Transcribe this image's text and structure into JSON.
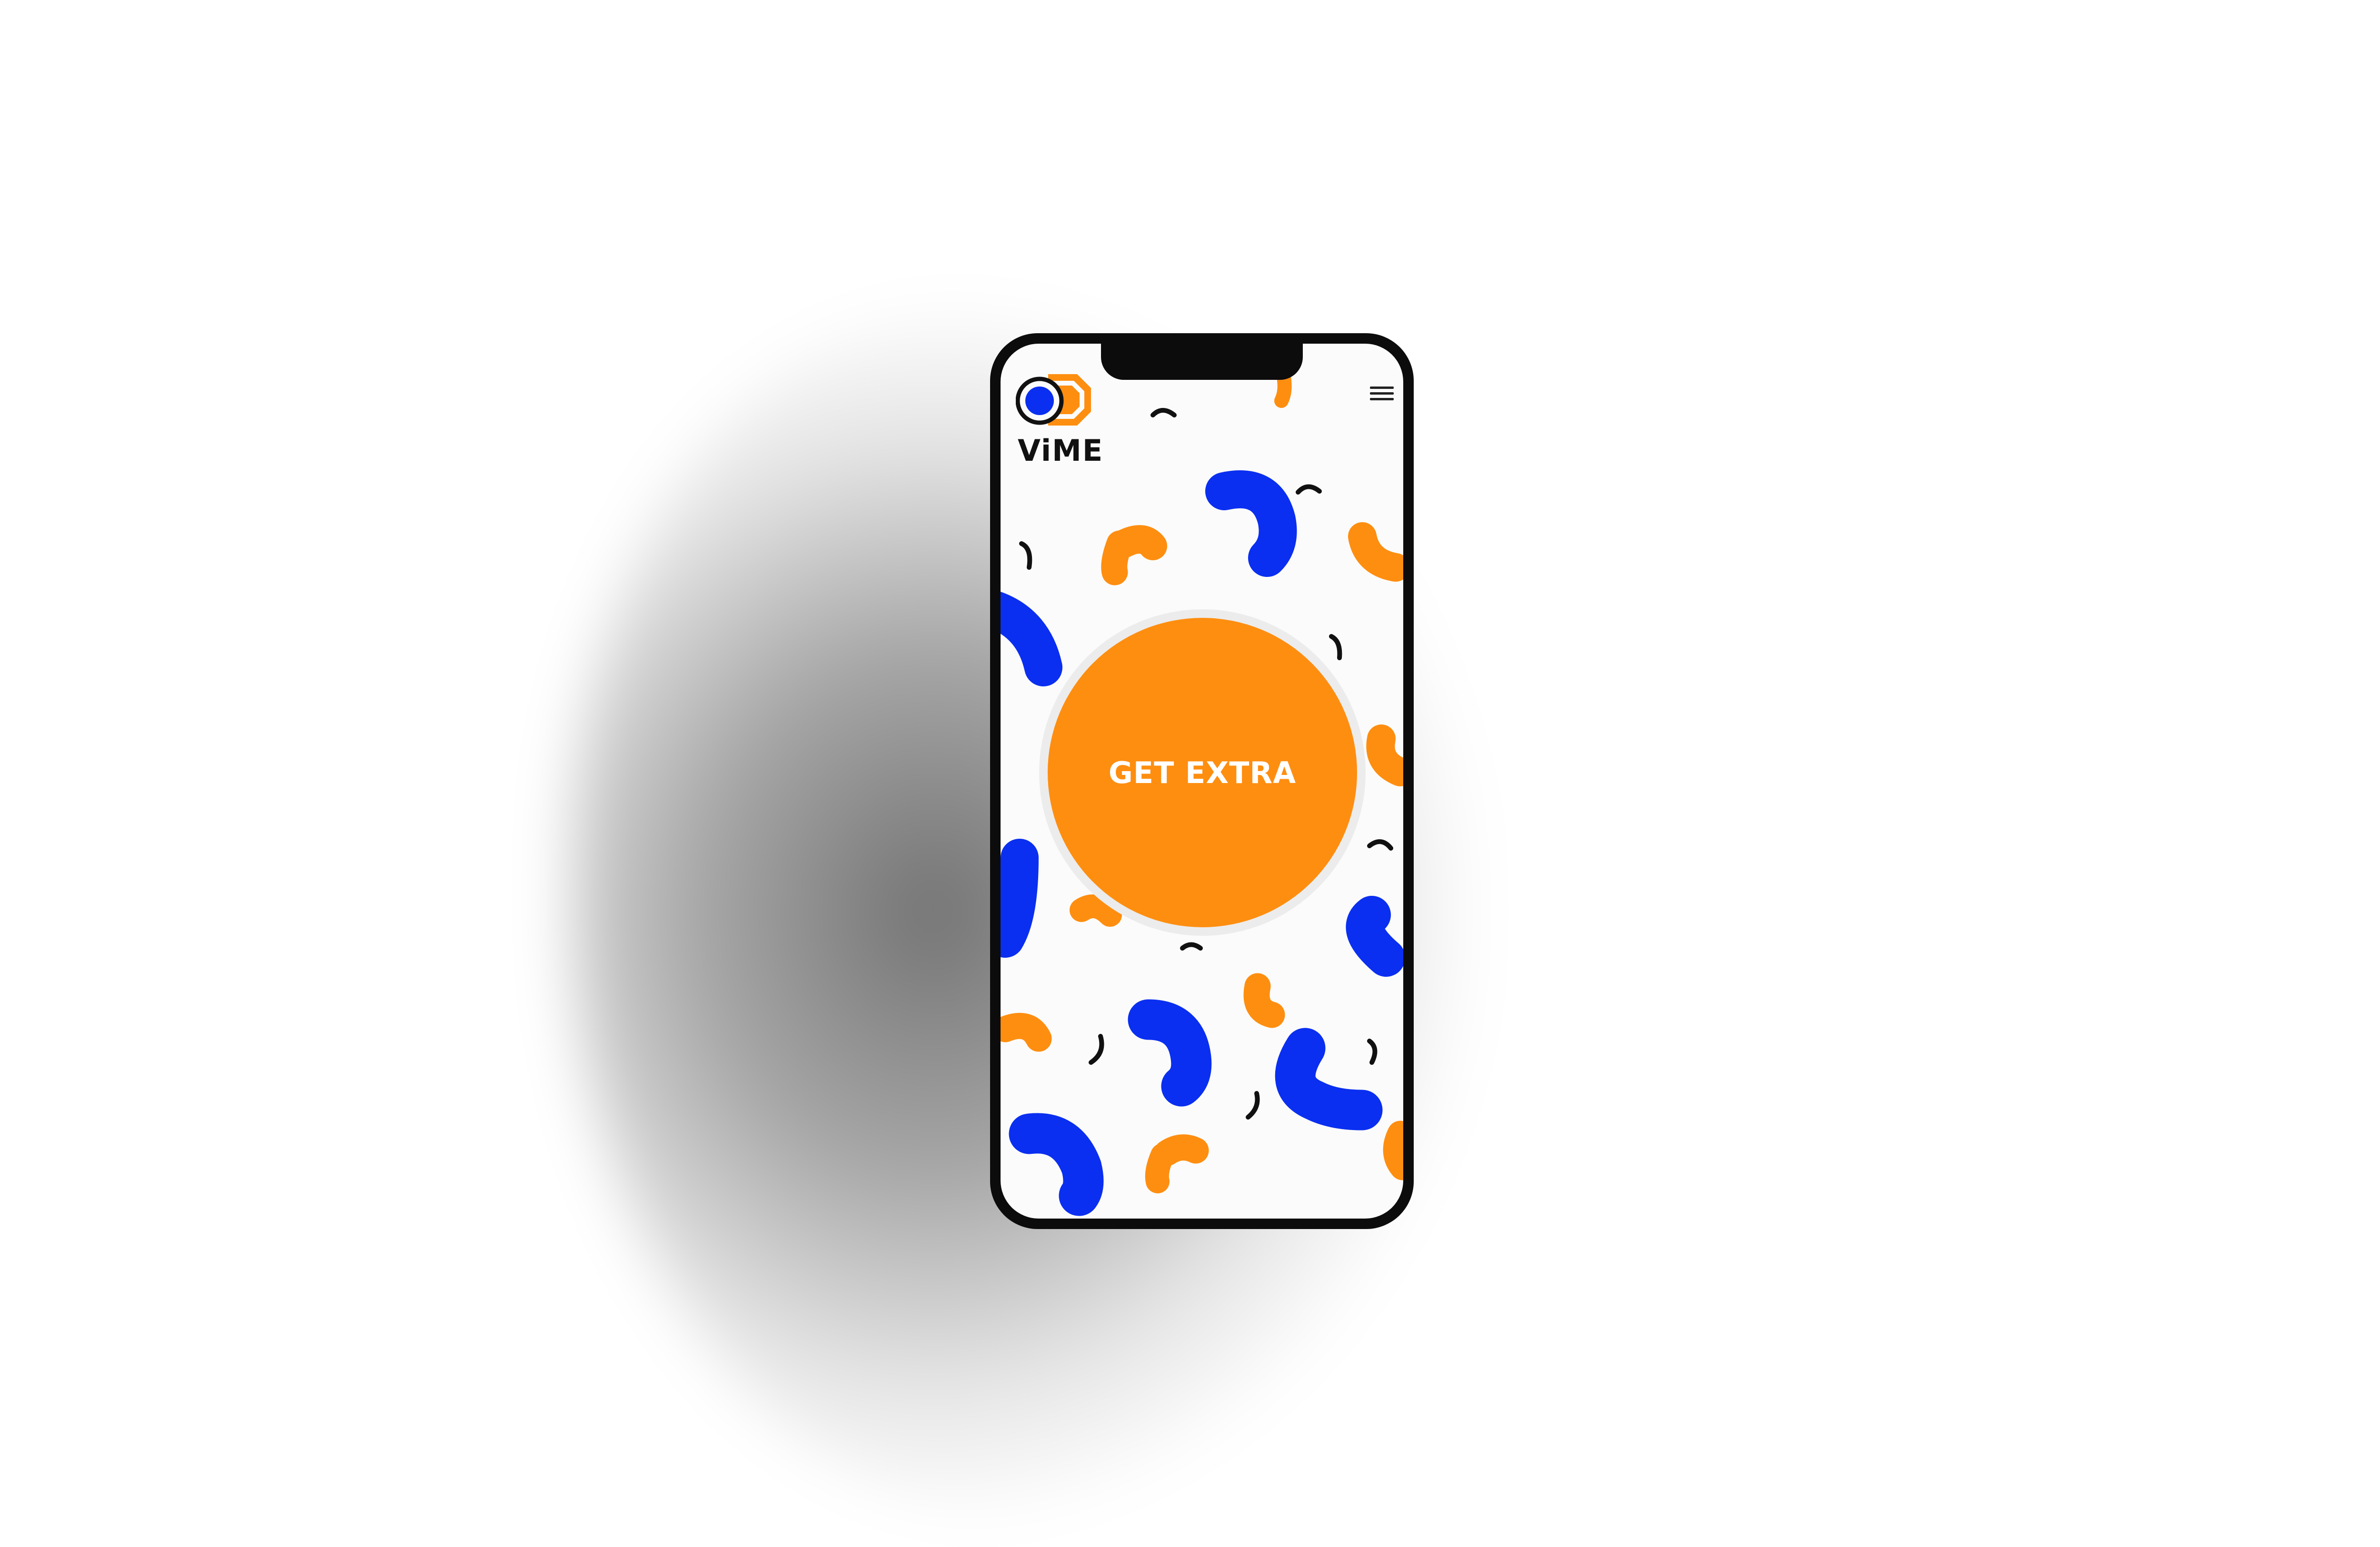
{
  "app": {
    "brand_name": "ViME"
  },
  "header": {
    "logo_icon": "vime-logo-icon",
    "menu_icon": "hamburger-menu-icon"
  },
  "main": {
    "cta_label": "GET EXTRA"
  },
  "colors": {
    "accent_orange": "#fe8e10",
    "accent_blue": "#0a2ff0",
    "ink": "#111111",
    "screen_bg": "#fbfbfb"
  }
}
